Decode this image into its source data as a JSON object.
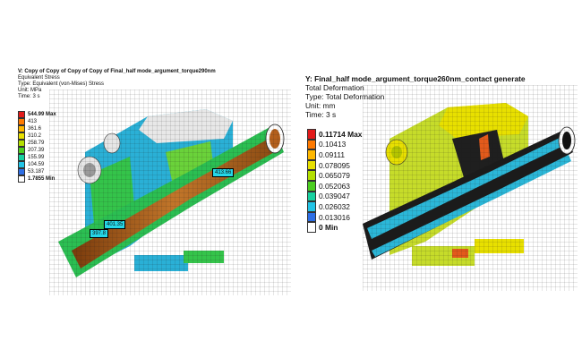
{
  "left": {
    "title": "V: Copy of Copy of Copy of Copy of Final_half mode_argument_torque290nm",
    "result": "Equivalent Stress",
    "type": "Type: Equivalent (von-Mises) Stress",
    "unit": "Unit: MPa",
    "time": "Time: 3 s",
    "legend": [
      {
        "label": "544.99 Max",
        "color": "#e31b1b",
        "bold": true
      },
      {
        "label": "413",
        "color": "#ff7a00",
        "bold": false
      },
      {
        "label": "361.6",
        "color": "#ffb800",
        "bold": false
      },
      {
        "label": "310.2",
        "color": "#e8e000",
        "bold": false
      },
      {
        "label": "258.79",
        "color": "#b4e000",
        "bold": false
      },
      {
        "label": "207.39",
        "color": "#4ccf20",
        "bold": false
      },
      {
        "label": "155.99",
        "color": "#17d1a0",
        "bold": false
      },
      {
        "label": "104.59",
        "color": "#22c4e6",
        "bold": false
      },
      {
        "label": "53.187",
        "color": "#2e6fe6",
        "bold": false
      },
      {
        "label": "1.7855 Min",
        "color": "#ffffff",
        "bold": true
      }
    ],
    "probes": [
      "413.66",
      "401.35",
      "397.8"
    ]
  },
  "right": {
    "title": "Y: Final_half mode_argument_torque260nm_contact generate",
    "result": "Total Deformation",
    "type": "Type: Total Deformation",
    "unit": "Unit: mm",
    "time": "Time: 3 s",
    "legend": [
      {
        "label": "0.11714 Max",
        "color": "#e31b1b",
        "bold": true
      },
      {
        "label": "0.10413",
        "color": "#ff7a00",
        "bold": false
      },
      {
        "label": "0.09111",
        "color": "#ffb800",
        "bold": false
      },
      {
        "label": "0.078095",
        "color": "#e8e000",
        "bold": false
      },
      {
        "label": "0.065079",
        "color": "#b4e000",
        "bold": false
      },
      {
        "label": "0.052063",
        "color": "#4ccf20",
        "bold": false
      },
      {
        "label": "0.039047",
        "color": "#17d1a0",
        "bold": false
      },
      {
        "label": "0.026032",
        "color": "#22c4e6",
        "bold": false
      },
      {
        "label": "0.013016",
        "color": "#2e6fe6",
        "bold": false
      },
      {
        "label": "0 Min",
        "color": "#ffffff",
        "bold": true
      }
    ]
  }
}
